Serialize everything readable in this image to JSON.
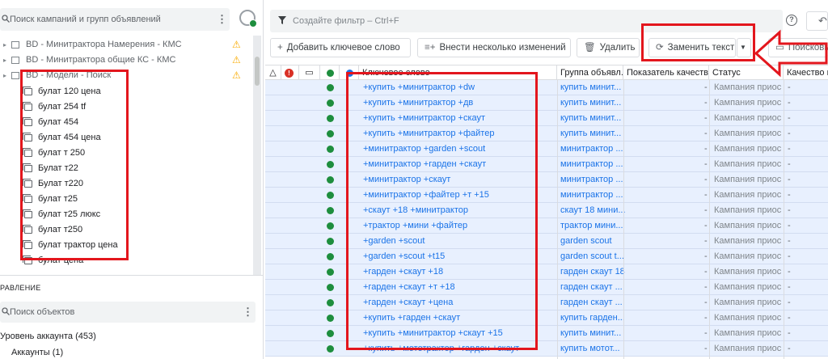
{
  "left_panel": {
    "search_placeholder": "Поиск кампаний и групп объявлений",
    "campaigns": [
      {
        "label": "BD - Минитрактора Намерения - КМС",
        "warning": true
      },
      {
        "label": "BD - Минитрактора общие КС - КМС",
        "warning": true
      },
      {
        "label": "BD - Модели - Поиск",
        "warning": true
      }
    ],
    "ad_groups": [
      "булат 120 цена",
      "булат 254 tf",
      "булат 454",
      "булат 454 цена",
      "булат т 250",
      "Булат т22",
      "Булат т220",
      "булат т25",
      "булат т25 люкс",
      "булат т250",
      "булат трактор цена",
      "булат цена"
    ],
    "management_title": "РАВЛЕНИЕ",
    "objects_search_placeholder": "Поиск объектов",
    "account_level": "Уровень аккаунта (453)",
    "accounts": "Аккаунты (1)"
  },
  "filter": {
    "placeholder": "Создайте фильтр – Ctrl+F"
  },
  "toolbar": {
    "add_keyword": "Добавить ключевое слово",
    "bulk_changes": "Внести несколько изменений",
    "delete": "Удалить",
    "replace_text": "Заменить текст",
    "search_partial": "Поисковые з"
  },
  "grid": {
    "headers": {
      "keyword": "Ключевое слово",
      "ad_group": "Группа объявл...",
      "quality_score": "Показатель качества",
      "status": "Статус",
      "quality2": "Качество ц"
    },
    "rows": [
      {
        "keyword": "+купить +минитрактор +dw",
        "ad_group": "купить минит...",
        "qs": "-",
        "status": "Кампания приос...",
        "q2": "-"
      },
      {
        "keyword": "+купить +минитрактор +дв",
        "ad_group": "купить минит...",
        "qs": "-",
        "status": "Кампания приос...",
        "q2": "-"
      },
      {
        "keyword": "+купить +минитрактор +скаут",
        "ad_group": "купить минит...",
        "qs": "-",
        "status": "Кампания приос...",
        "q2": "-"
      },
      {
        "keyword": "+купить +минитрактор +файтер",
        "ad_group": "купить минит...",
        "qs": "-",
        "status": "Кампания приос...",
        "q2": "-"
      },
      {
        "keyword": "+минитрактор +garden +scout",
        "ad_group": "минитрактор ...",
        "qs": "-",
        "status": "Кампания приос...",
        "q2": "-"
      },
      {
        "keyword": "+минитрактор +гарден +скаут",
        "ad_group": "минитрактор ...",
        "qs": "-",
        "status": "Кампания приос...",
        "q2": "-"
      },
      {
        "keyword": "+минитрактор +скаут",
        "ad_group": "минитрактор ...",
        "qs": "-",
        "status": "Кампания приос...",
        "q2": "-"
      },
      {
        "keyword": "+минитрактор +файтер +т +15",
        "ad_group": "минитрактор ...",
        "qs": "-",
        "status": "Кампания приос...",
        "q2": "-"
      },
      {
        "keyword": "+скаут +18 +минитрактор",
        "ad_group": "скаут 18 мини...",
        "qs": "-",
        "status": "Кампания приос...",
        "q2": "-"
      },
      {
        "keyword": "+трактор +мини +файтер",
        "ad_group": "трактор мини...",
        "qs": "-",
        "status": "Кампания приос...",
        "q2": "-"
      },
      {
        "keyword": "+garden +scout",
        "ad_group": "garden scout",
        "qs": "-",
        "status": "Кампания приос...",
        "q2": "-"
      },
      {
        "keyword": "+garden +scout +t15",
        "ad_group": "garden scout t...",
        "qs": "-",
        "status": "Кампания приос...",
        "q2": "-"
      },
      {
        "keyword": "+гарден +скаут +18",
        "ad_group": "гарден скаут 18",
        "qs": "-",
        "status": "Кампания приос...",
        "q2": "-"
      },
      {
        "keyword": "+гарден +скаут +т +18",
        "ad_group": "гарден скаут ...",
        "qs": "-",
        "status": "Кампания приос...",
        "q2": "-"
      },
      {
        "keyword": "+гарден +скаут +цена",
        "ad_group": "гарден скаут ...",
        "qs": "-",
        "status": "Кампания приос...",
        "q2": "-"
      },
      {
        "keyword": "+купить +гарден +скаут",
        "ad_group": "купить гарден...",
        "qs": "-",
        "status": "Кампания приос...",
        "q2": "-"
      },
      {
        "keyword": "+купить +минитрактор +скаут +15",
        "ad_group": "купить минит...",
        "qs": "-",
        "status": "Кампания приос...",
        "q2": "-"
      },
      {
        "keyword": "+купить +мототрактор +гарден +скаут",
        "ad_group": "купить мотот...",
        "qs": "-",
        "status": "Кампания приос...",
        "q2": "-"
      }
    ]
  },
  "colors": {
    "accent": "#1a73e8",
    "status_green": "#1e8e3e",
    "warning": "#f9ab00",
    "annotation_red": "#e3161d",
    "selected_row": "#e8f0fe"
  }
}
